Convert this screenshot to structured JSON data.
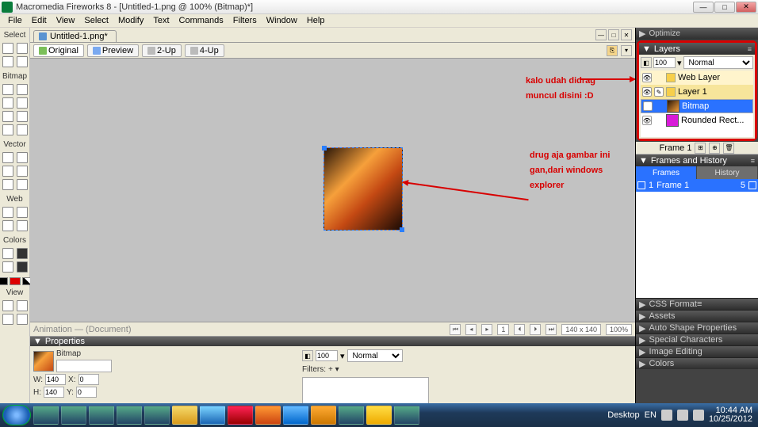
{
  "titlebar": {
    "app": "Macromedia Fireworks 8 - [Untitled-1.png @ 100% (Bitmap)*]"
  },
  "menu": [
    "File",
    "Edit",
    "View",
    "Select",
    "Modify",
    "Text",
    "Commands",
    "Filters",
    "Window",
    "Help"
  ],
  "tool_sections": {
    "select": "Select",
    "bitmap": "Bitmap",
    "vector": "Vector",
    "web": "Web",
    "colors": "Colors",
    "view": "View"
  },
  "doc_tab": "Untitled-1.png*",
  "view_tabs": {
    "original": "Original",
    "preview": "Preview",
    "twoup": "2-Up",
    "fourup": "4-Up"
  },
  "annotations": {
    "a1_l1": "kalo udah didrag",
    "a1_l2": "muncul disini :D",
    "a2_l1": "drug aja gambar ini",
    "a2_l2": "gan,dari windows",
    "a2_l3": "explorer"
  },
  "status": {
    "left": "Animation — (Document)",
    "page": "1",
    "dims": "140 x 140",
    "zoom": "100%"
  },
  "properties": {
    "title": "Properties",
    "type": "Bitmap",
    "name": "",
    "w": "140",
    "x": "0",
    "h": "140",
    "y": "0",
    "w_lbl": "W:",
    "x_lbl": "X:",
    "h_lbl": "H:",
    "y_lbl": "Y:",
    "opac": "100",
    "opac_suffix": "▾",
    "blend": "Normal",
    "filters_lbl": "Filters:",
    "filters_add": "+ ▾"
  },
  "panels": {
    "layers": {
      "title": "Layers",
      "opacity": "100",
      "blend": "Normal",
      "web": "Web Layer",
      "layer1": "Layer 1",
      "bitmap": "Bitmap",
      "rect": "Rounded Rect..."
    },
    "frame_label": "Frame 1",
    "frames_history": {
      "title": "Frames and History",
      "tab_frames": "Frames",
      "tab_history": "History",
      "row_num": "1",
      "row_name": "Frame 1",
      "row_delay": "5"
    },
    "accordion": [
      "CSS Format",
      "Assets",
      "Auto Shape Properties",
      "Special Characters",
      "Image Editing",
      "Colors"
    ]
  },
  "tray": {
    "desktop": "Desktop",
    "lang": "EN",
    "time": "10:44 AM",
    "date": "10/25/2012"
  }
}
